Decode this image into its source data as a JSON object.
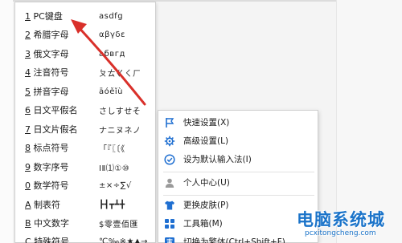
{
  "keyboard_menu": {
    "items": [
      {
        "num": "1",
        "label": "PC键盘",
        "sample": "asdfg"
      },
      {
        "num": "2",
        "label": "希腊字母",
        "sample": "αβγδε"
      },
      {
        "num": "3",
        "label": "俄文字母",
        "sample": "абвгд"
      },
      {
        "num": "4",
        "label": "注音符号",
        "sample": "ㄆㄊㄍㄑㄏ"
      },
      {
        "num": "5",
        "label": "拼音字母",
        "sample": "āóěǐù"
      },
      {
        "num": "6",
        "label": "日文平假名",
        "sample": "さしすせそ"
      },
      {
        "num": "7",
        "label": "日文片假名",
        "sample": "ナニヌネノ"
      },
      {
        "num": "8",
        "label": "标点符号",
        "sample": "「『〖〔《"
      },
      {
        "num": "9",
        "label": "数字序号",
        "sample": "ⅠⅡ⑴①⑩"
      },
      {
        "num": "0",
        "label": "数学符号",
        "sample": "±×÷∑√"
      },
      {
        "num": "A",
        "label": "制表符",
        "sample": "┣┫┳┻╋"
      },
      {
        "num": "B",
        "label": "中文数字",
        "sample": "$零壹佰匯"
      },
      {
        "num": "C",
        "label": "特殊符号",
        "sample": "℃‰※★▲→"
      }
    ]
  },
  "context_menu": {
    "items": [
      {
        "icon": "flag-icon",
        "label": "快速设置(X)"
      },
      {
        "icon": "gear-icon",
        "label": "高级设置(L)"
      },
      {
        "icon": "check-circle-icon",
        "label": "设为默认输入法(I)"
      },
      {
        "icon": "user-icon",
        "label": "个人中心(U)"
      },
      {
        "icon": "skin-icon",
        "label": "更换皮肤(P)"
      },
      {
        "icon": "toolbox-icon",
        "label": "工具箱(M)"
      },
      {
        "icon": "traditional-icon",
        "label": "切换为繁体(Ctrl+Shift+F)"
      }
    ]
  },
  "watermark": {
    "title": "电脑系统城",
    "url": "pcxitongcheng.com"
  },
  "colors": {
    "arrow": "#d9302a",
    "icon_blue": "#1f6fd1",
    "watermark": "#1a73c9"
  }
}
